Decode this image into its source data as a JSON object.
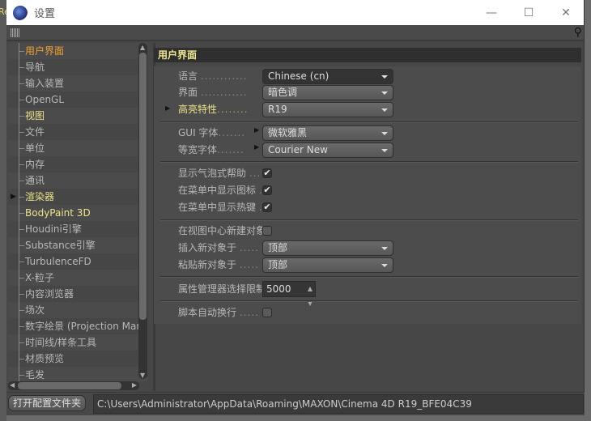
{
  "background_window": {
    "text": "Re"
  },
  "window": {
    "title": "设置",
    "minimize": "—",
    "maximize": "☐",
    "close": "✕"
  },
  "tree": {
    "items": [
      {
        "label": "用户界面",
        "state": "selected"
      },
      {
        "label": "导航"
      },
      {
        "label": "输入装置"
      },
      {
        "label": "OpenGL"
      },
      {
        "label": "视图",
        "state": "highlight"
      },
      {
        "label": "文件"
      },
      {
        "label": "单位"
      },
      {
        "label": "内存"
      },
      {
        "label": "通讯"
      },
      {
        "label": "渲染器",
        "state": "highlight",
        "expandable": true
      },
      {
        "label": "BodyPaint 3D",
        "state": "highlight"
      },
      {
        "label": "Houdini引擎"
      },
      {
        "label": "Substance引擎"
      },
      {
        "label": "TurbulenceFD"
      },
      {
        "label": "X-粒子"
      },
      {
        "label": "内容浏览器"
      },
      {
        "label": "场次"
      },
      {
        "label": "数字绘景 (Projection Man)"
      },
      {
        "label": "时间线/样条工具"
      },
      {
        "label": "材质预览"
      },
      {
        "label": "毛发"
      }
    ]
  },
  "section": {
    "title": "用户界面"
  },
  "fields": {
    "language": {
      "label": "语言",
      "dots": "............",
      "value": "Chinese (cn)"
    },
    "interface": {
      "label": "界面",
      "dots": "............",
      "value": "暗色调"
    },
    "highlight": {
      "label": "高亮特性",
      "dots": "........",
      "value": "R19"
    },
    "gui_font": {
      "label": "GUI 字体",
      "dots": ".......",
      "value": "微软雅黑"
    },
    "mono_font": {
      "label": "等宽字体",
      "dots": ".......",
      "value": "Courier New"
    },
    "bubble_help": {
      "label": "显示气泡式帮助",
      "dots": "...",
      "checked": true
    },
    "menu_icons": {
      "label": "在菜单中显示图标",
      "dots": ".",
      "checked": true
    },
    "menu_hotkeys": {
      "label": "在菜单中显示热键",
      "dots": ".",
      "checked": true
    },
    "new_at_center": {
      "label": "在视图中心新建对象",
      "checked": false
    },
    "insert_at": {
      "label": "插入新对象于",
      "dots": ".....",
      "value": "顶部"
    },
    "paste_at": {
      "label": "粘贴新对象于",
      "dots": ".....",
      "value": "顶部"
    },
    "am_limit": {
      "label": "属性管理器选择限制",
      "value": "5000"
    },
    "script_wrap": {
      "label": "脚本自动换行",
      "dots": ".....",
      "checked": false
    }
  },
  "check_glyph": "✔",
  "bottom": {
    "open_folder": "打开配置文件夹",
    "path": "C:\\Users\\Administrator\\AppData\\Roaming\\MAXON\\Cinema 4D R19_BFE04C39"
  },
  "colors": {
    "selected": "#f0a030",
    "highlight": "#ece48a",
    "background": "#474747"
  }
}
